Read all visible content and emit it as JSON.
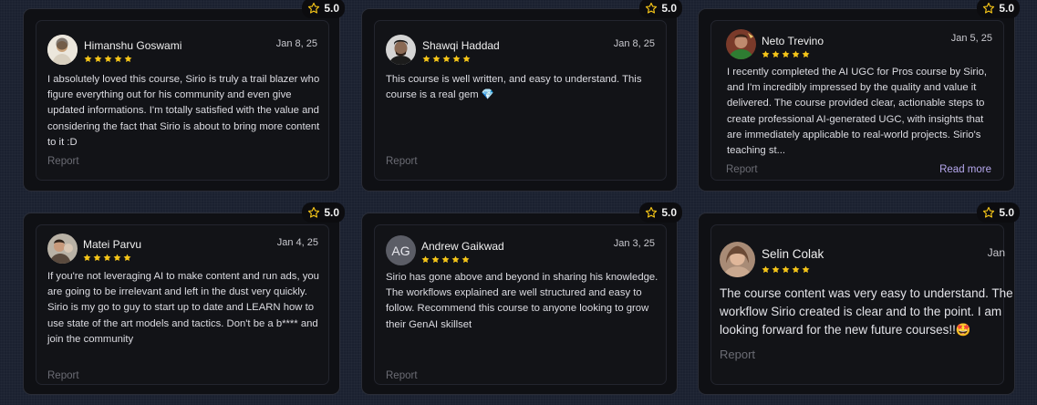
{
  "reviews": [
    {
      "name": "Himanshu Goswami",
      "date": "Jan 8, 25",
      "rating": "5.0",
      "stars": 5,
      "text": "I absolutely loved this course, Sirio is truly a trail blazer who figure everything out for his community and even give updated informations. I'm totally satisfied with the value and considering the fact that Sirio is about to bring more content to it :D",
      "report": "Report"
    },
    {
      "name": "Shawqi Haddad",
      "date": "Jan 8, 25",
      "rating": "5.0",
      "stars": 5,
      "text": "This course is well written, and easy to understand. This course is a real gem 💎",
      "report": "Report"
    },
    {
      "name": "Neto Trevino",
      "date": "Jan 5, 25",
      "rating": "5.0",
      "stars": 5,
      "text": "I recently completed the AI UGC for Pros course by Sirio, and I'm incredibly impressed by the quality and value it delivered. The course provided clear, actionable steps to create professional AI-generated UGC, with insights that are immediately applicable to real-world projects. Sirio's teaching st...",
      "report": "Report",
      "read_more": "Read more"
    },
    {
      "name": "Matei Parvu",
      "date": "Jan 4, 25",
      "rating": "5.0",
      "stars": 5,
      "text": "If you're not leveraging AI to make content and run ads, you are going to be irrelevant and left in the dust very quickly. Sirio is my go to guy to start up to date and LEARN how to use state of the art models and tactics. Don't be a b**** and join the community",
      "report": "Report"
    },
    {
      "name": "Andrew Gaikwad",
      "initials": "AG",
      "date": "Jan 3, 25",
      "rating": "5.0",
      "stars": 5,
      "text": "Sirio has gone above and beyond in sharing his knowledge. The workflows explained are well structured and easy to follow. Recommend this course to anyone looking to grow their GenAI skillset",
      "report": "Report"
    },
    {
      "name": "Selin Colak",
      "date": "Jan",
      "rating": "5.0",
      "stars": 5,
      "text": "The course content was very easy to understand. The workflow Sirio created is clear and to the point. I am looking forward for the new future courses!!🤩",
      "report": "Report"
    }
  ],
  "colors": {
    "star": "#f5c518",
    "badge_star_outline": "#f5c518",
    "read_more": "#b6a8ee"
  }
}
